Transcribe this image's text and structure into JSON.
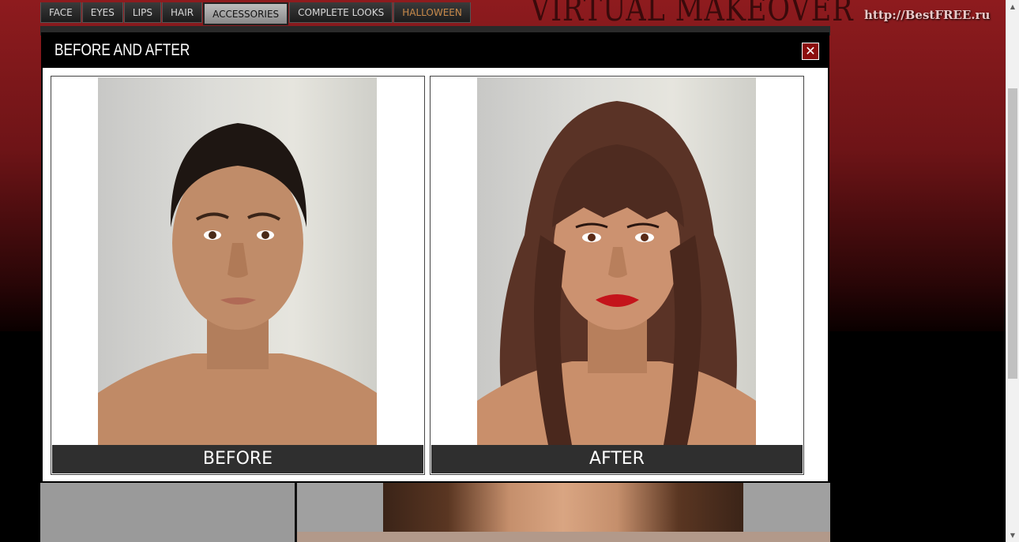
{
  "nav": {
    "tabs": [
      {
        "label": "FACE"
      },
      {
        "label": "EYES"
      },
      {
        "label": "LIPS"
      },
      {
        "label": "HAIR"
      },
      {
        "label": "ACCESSORIES"
      },
      {
        "label": "COMPLETE LOOKS"
      },
      {
        "label": "HALLOWEEN"
      }
    ],
    "active_tab": "ACCESSORIES"
  },
  "brand": {
    "title": "VIRTUAL MAKEOVER"
  },
  "watermark": {
    "text": "http://BestFREE.ru"
  },
  "modal": {
    "title": "BEFORE AND AFTER",
    "close_symbol": "✕",
    "before_label": "BEFORE",
    "after_label": "AFTER"
  },
  "colors": {
    "background_red": "#8e1b1e",
    "modal_header": "#000000",
    "label_bar": "#2f2f2f",
    "close_button": "#8b0d0d",
    "lipstick": "#c4141b",
    "hair": "#5a3326"
  },
  "icons": {
    "close": "close-icon",
    "scroll_up": "scroll-up-arrow-icon",
    "scroll_down": "scroll-down-arrow-icon"
  }
}
